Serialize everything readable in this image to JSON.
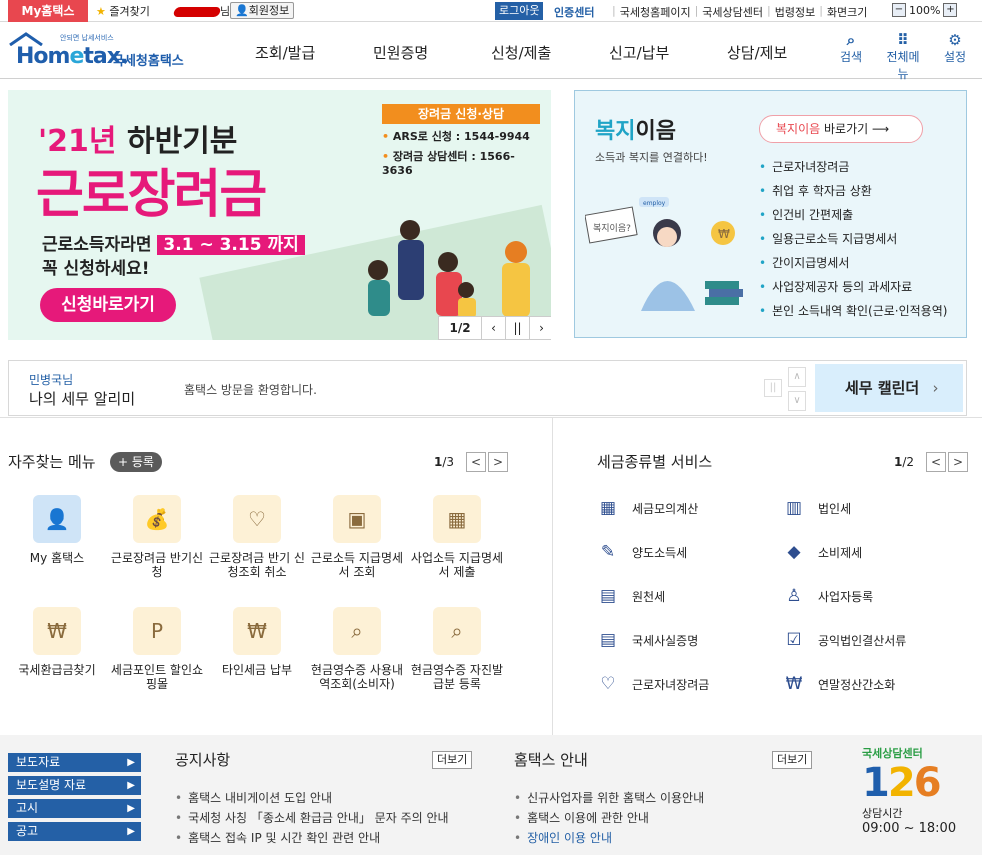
{
  "topbar": {
    "my_hometax": "My홈택스",
    "favorites": "즐겨찾기",
    "user_suffix": "님",
    "member_info": "회원정보",
    "logout": "로그아웃",
    "cert_center": "인증센터",
    "links": [
      "국세청홈페이지",
      "국세상담센터",
      "법령정보"
    ],
    "screen_size": "화면크기",
    "zoom": "100%",
    "zoom_minus": "−",
    "zoom_plus": "+"
  },
  "header": {
    "logo_sub": "안되면 납세서비스",
    "logo_text_a": "Hom",
    "logo_text_e": "e",
    "logo_text_b": "tax.",
    "logo_kr": "국세청홈택스",
    "gnb": [
      "조회/발급",
      "민원증명",
      "신청/제출",
      "신고/납부",
      "상담/제보"
    ],
    "icons": [
      {
        "label": "검색",
        "icon": "search-icon",
        "glyph": "🔍"
      },
      {
        "label": "전체메뉴",
        "icon": "grid-icon",
        "glyph": "⠿"
      },
      {
        "label": "설정",
        "icon": "gear-icon",
        "glyph": "⚙"
      }
    ]
  },
  "banner": {
    "year_prefix": "'21년",
    "year_suffix": " 하반기분",
    "title": "근로장려금",
    "condition_a": "근로소득자라면 ",
    "condition_hl": "3.1 ~ 3.15 까지",
    "condition_b": "꼭 신청하세요!",
    "apply_button": "신청바로가기",
    "box_title": "장려금 신청·상담",
    "box_line1": "ARS로 신청 : 1544-9944",
    "box_line2": "장려금 상담센터 : 1566-3636",
    "page": "1",
    "page_total": "/2",
    "prev": "‹",
    "pause": "||",
    "next": "›"
  },
  "welfare": {
    "title_a": "복지",
    "title_b": "이음",
    "subtitle": "소득과 복지를 연결하다!",
    "button_a": "복지이음",
    "button_b": " 바로가기  ⟶",
    "items": [
      "근로자녀장려금",
      "취업 후 학자금 상환",
      "인건비 간편제출",
      "일용근로소득 지급명세서",
      "간이지급명세서",
      "사업장제공자 등의 과세자료",
      "본인 소득내역 확인(근로·인적용역)"
    ],
    "sign_text": "복지이음?",
    "tag_text": "employ"
  },
  "notice_bar": {
    "label_small": "민병국님",
    "label_big": "나의 세무 알리미",
    "message": "홈택스 방문을 환영합니다.",
    "pause": "||",
    "up": "∧",
    "down": "∨",
    "calendar": "세무 캘린더",
    "calendar_arrow": "›"
  },
  "favorites": {
    "title": "자주찾는 메뉴",
    "register": "+ 등록",
    "page": "1",
    "page_total": "/3",
    "prev": "<",
    "next": ">",
    "items": [
      {
        "label": "My 홈택스",
        "icon": "user-icon",
        "glyph": "👤"
      },
      {
        "label": "근로장려금 반기신청",
        "icon": "money-bag-icon",
        "glyph": "💰"
      },
      {
        "label": "근로장려금 반기 신청조회 취소",
        "icon": "heart-hand-icon",
        "glyph": "♡"
      },
      {
        "label": "근로소득 지급명세서 조회",
        "icon": "wallet-icon",
        "glyph": "👛"
      },
      {
        "label": "사업소득 지급명세서 제출",
        "icon": "calendar-edit-icon",
        "glyph": "📅"
      },
      {
        "label": "국세환급금찾기",
        "icon": "refund-icon",
        "glyph": "₩"
      },
      {
        "label": "세금포인트 할인쇼핑몰",
        "icon": "tax-point-icon",
        "glyph": "P"
      },
      {
        "label": "타인세금 납부",
        "icon": "tax-payment-icon",
        "glyph": "₩"
      },
      {
        "label": "현금영수증 사용내역조회(소비자)",
        "icon": "receipt-search-icon",
        "glyph": "🧾"
      },
      {
        "label": "현금영수증 자진발급분 등록",
        "icon": "receipt-register-icon",
        "glyph": "🧾"
      }
    ]
  },
  "tax_services": {
    "title": "세금종류별 서비스",
    "page": "1",
    "page_total": "/2",
    "prev": "<",
    "next": ">",
    "items": [
      {
        "label": "세금모의계산",
        "icon": "calculator-icon",
        "glyph": "▦"
      },
      {
        "label": "법인세",
        "icon": "building-icon",
        "glyph": "▥"
      },
      {
        "label": "양도소득세",
        "icon": "document-pen-icon",
        "glyph": "✎"
      },
      {
        "label": "소비제세",
        "icon": "diamond-icon",
        "glyph": "◆"
      },
      {
        "label": "원천세",
        "icon": "salary-icon",
        "glyph": "▤"
      },
      {
        "label": "사업자등록",
        "icon": "person-icon",
        "glyph": "♙"
      },
      {
        "label": "국세사실증명",
        "icon": "certificate-icon",
        "glyph": "▤"
      },
      {
        "label": "공익법인결산서류",
        "icon": "checklist-icon",
        "glyph": "☑"
      },
      {
        "label": "근로자녀장려금",
        "icon": "heart-icon",
        "glyph": "♡"
      },
      {
        "label": "연말정산간소화",
        "icon": "won-coin-icon",
        "glyph": "₩"
      }
    ]
  },
  "bottom": {
    "left_menu": [
      "보도자료",
      "보도설명 자료",
      "고시",
      "공고"
    ],
    "notice_title": "공지사항",
    "notice_more": "더보기",
    "notices": [
      "홈택스 내비게이션 도입 안내",
      "국세청 사칭 「종소세 환급금 안내」 문자 주의 안내",
      "홈택스 접속 IP 및 시간 확인 관련 안내"
    ],
    "guide_title": "홈택스 안내",
    "guide_more": "더보기",
    "guides": [
      "신규사업자를 위한 홈택스 이용안내",
      "홈택스 이용에 관한 안내",
      "장애인 이용 안내"
    ],
    "center_label": "국세상담센터",
    "center_digit1": "1",
    "center_digit2": "2",
    "center_digit3": "6",
    "hours_label": "상담시간",
    "hours": "09:00 ~ 18:00"
  }
}
